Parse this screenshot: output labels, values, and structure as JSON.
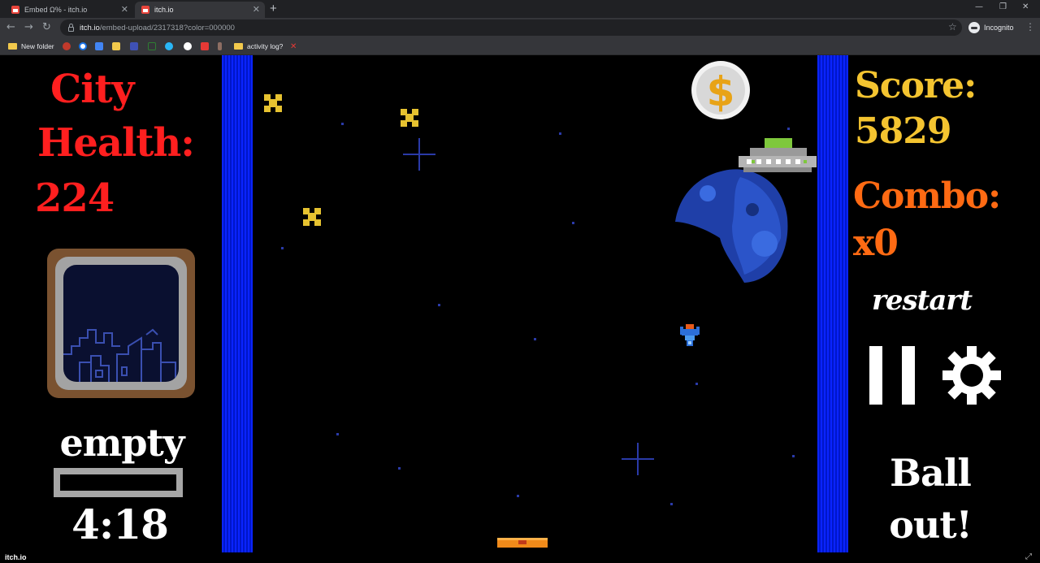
{
  "browser": {
    "tabs": [
      {
        "title": "Embed Ω% - itch.io",
        "active": false
      },
      {
        "title": "itch.io",
        "active": true
      }
    ],
    "url_host": "itch.io",
    "url_path": "/embed-upload/2317318?color=000000",
    "profile_label": "Incognito",
    "bookmarks": [
      {
        "label": "New folder",
        "icon": "folder-icon"
      },
      {
        "label": "activity log?",
        "icon": "folder-icon"
      }
    ]
  },
  "game": {
    "city_label_line1": "City",
    "city_label_line2": "Health:",
    "city_health": "224",
    "held_item": "empty",
    "power_level": 0,
    "timer": "4:18",
    "score_label": "Score:",
    "score": "5829",
    "combo_label": "Combo:",
    "combo": "x0",
    "restart_label": "restart",
    "ball_status_line1": "Ball",
    "ball_status_line2": "out!",
    "colors": {
      "health": "#ff1f1f",
      "score": "#f4c430",
      "combo": "#ff6a13",
      "wall": "#0a24ff",
      "coin": "#e8a317"
    },
    "coin_symbol": "$",
    "icons": [
      "coin-icon",
      "ufo-sprite",
      "planet-sprite",
      "ship-sprite",
      "paddle-sprite",
      "star-powerup",
      "pause-icon",
      "gear-icon"
    ]
  },
  "footer": {
    "brand": "itch.io"
  }
}
